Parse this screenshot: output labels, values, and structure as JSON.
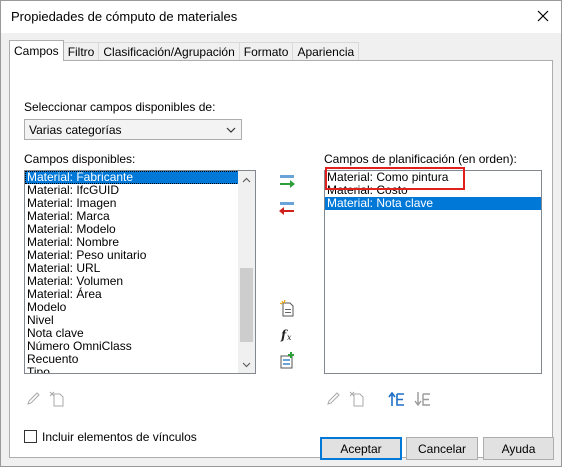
{
  "dialog": {
    "title": "Propiedades de cómputo de materiales"
  },
  "tabs": [
    {
      "label": "Campos"
    },
    {
      "label": "Filtro"
    },
    {
      "label": "Clasificación/Agrupación"
    },
    {
      "label": "Formato"
    },
    {
      "label": "Apariencia"
    }
  ],
  "fields": {
    "select_label": "Seleccionar campos disponibles de:",
    "category_value": "Varias categorías",
    "available_label": "Campos disponibles:",
    "scheduled_label": "Campos de planificación (en orden):",
    "available_items": [
      "Material: Fabricante",
      "Material: IfcGUID",
      "Material: Imagen",
      "Material: Marca",
      "Material: Modelo",
      "Material: Nombre",
      "Material: Peso unitario",
      "Material: URL",
      "Material: Volumen",
      "Material: Área",
      "Modelo",
      "Nivel",
      "Nota clave",
      "Número OmniClass",
      "Recuento",
      "Tipo"
    ],
    "scheduled_items": [
      "Material: Como pintura",
      "Material: Costo",
      "Material: Nota clave"
    ],
    "include_links_label": "Incluir elementos de vínculos"
  },
  "buttons": {
    "accept": "Aceptar",
    "cancel": "Cancelar",
    "help": "Ayuda"
  },
  "colors": {
    "selection": "#0078d7",
    "highlight_box": "#e0201c",
    "add_arrow": "#2e9e3a",
    "remove_arrow": "#d0201c"
  }
}
